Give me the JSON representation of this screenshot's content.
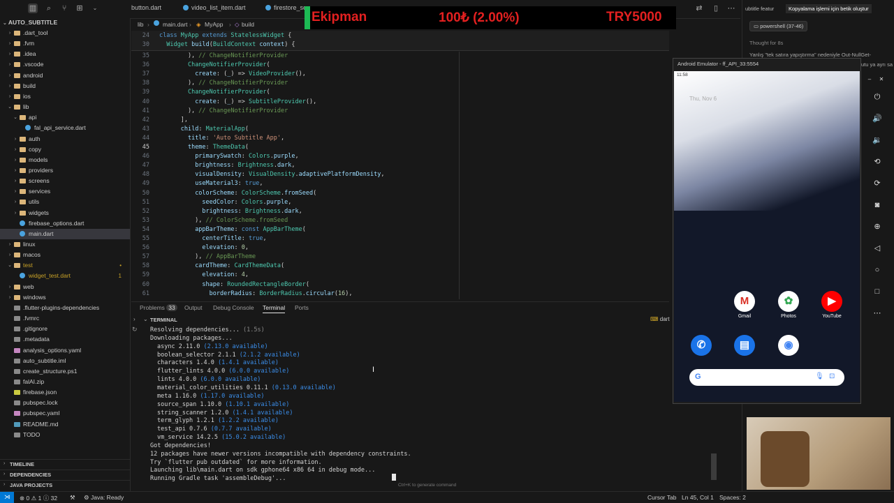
{
  "titlebar": {
    "tabs": [
      "button.dart",
      "video_list_item.dart",
      "firestore_se"
    ]
  },
  "explorer": {
    "root": "AUTO_SUBTITLE",
    "items": [
      {
        "label": ".dart_tool",
        "depth": 1,
        "type": "folder",
        "expanded": false
      },
      {
        "label": ".fvm",
        "depth": 1,
        "type": "folder",
        "expanded": false
      },
      {
        "label": ".idea",
        "depth": 1,
        "type": "folder",
        "expanded": false
      },
      {
        "label": ".vscode",
        "depth": 1,
        "type": "folder",
        "expanded": false
      },
      {
        "label": "android",
        "depth": 1,
        "type": "folder",
        "expanded": false
      },
      {
        "label": "build",
        "depth": 1,
        "type": "folder",
        "expanded": false
      },
      {
        "label": "ios",
        "depth": 1,
        "type": "folder",
        "expanded": false
      },
      {
        "label": "lib",
        "depth": 1,
        "type": "folder",
        "expanded": true
      },
      {
        "label": "api",
        "depth": 2,
        "type": "folder",
        "expanded": true
      },
      {
        "label": "fal_api_service.dart",
        "depth": 3,
        "type": "dart"
      },
      {
        "label": "auth",
        "depth": 2,
        "type": "folder",
        "expanded": false
      },
      {
        "label": "copy",
        "depth": 2,
        "type": "folder",
        "expanded": false
      },
      {
        "label": "models",
        "depth": 2,
        "type": "folder",
        "expanded": false
      },
      {
        "label": "providers",
        "depth": 2,
        "type": "folder",
        "expanded": false
      },
      {
        "label": "screens",
        "depth": 2,
        "type": "folder",
        "expanded": false
      },
      {
        "label": "services",
        "depth": 2,
        "type": "folder",
        "expanded": false
      },
      {
        "label": "utils",
        "depth": 2,
        "type": "folder",
        "expanded": false
      },
      {
        "label": "widgets",
        "depth": 2,
        "type": "folder",
        "expanded": false
      },
      {
        "label": "firebase_options.dart",
        "depth": 2,
        "type": "dart"
      },
      {
        "label": "main.dart",
        "depth": 2,
        "type": "dart",
        "selected": true
      },
      {
        "label": "linux",
        "depth": 1,
        "type": "folder",
        "expanded": false
      },
      {
        "label": "macos",
        "depth": 1,
        "type": "folder",
        "expanded": false
      },
      {
        "label": "test",
        "depth": 1,
        "type": "folder",
        "expanded": true,
        "badge": "•",
        "color": "#c9a227"
      },
      {
        "label": "widget_test.dart",
        "depth": 2,
        "type": "dart",
        "badge": "1",
        "color": "#c9a227"
      },
      {
        "label": "web",
        "depth": 1,
        "type": "folder",
        "expanded": false
      },
      {
        "label": "windows",
        "depth": 1,
        "type": "folder",
        "expanded": false
      },
      {
        "label": ".flutter-plugins-dependencies",
        "depth": 1,
        "type": "file"
      },
      {
        "label": ".fvmrc",
        "depth": 1,
        "type": "file"
      },
      {
        "label": ".gitignore",
        "depth": 1,
        "type": "file"
      },
      {
        "label": ".metadata",
        "depth": 1,
        "type": "file"
      },
      {
        "label": "analysis_options.yaml",
        "depth": 1,
        "type": "yaml"
      },
      {
        "label": "auto_subtitle.iml",
        "depth": 1,
        "type": "file"
      },
      {
        "label": "create_structure.ps1",
        "depth": 1,
        "type": "file"
      },
      {
        "label": "falAI.zip",
        "depth": 1,
        "type": "file"
      },
      {
        "label": "firebase.json",
        "depth": 1,
        "type": "json"
      },
      {
        "label": "pubspec.lock",
        "depth": 1,
        "type": "file"
      },
      {
        "label": "pubspec.yaml",
        "depth": 1,
        "type": "yaml"
      },
      {
        "label": "README.md",
        "depth": 1,
        "type": "md"
      },
      {
        "label": "TODO",
        "depth": 1,
        "type": "file"
      }
    ],
    "sections": [
      "TIMELINE",
      "DEPENDENCIES",
      "JAVA PROJECTS"
    ]
  },
  "editor": {
    "breadcrumb": [
      "lib",
      "main.dart",
      "MyApp",
      "build"
    ],
    "sticky": [
      {
        "n": "24",
        "text": "class MyApp extends StatelessWidget {"
      },
      {
        "n": "30",
        "text": "  Widget build(BuildContext context) {"
      }
    ],
    "lines": [
      {
        "n": "35",
        "text": "        ), // ChangeNotifierProvider"
      },
      {
        "n": "36",
        "text": "        ChangeNotifierProvider("
      },
      {
        "n": "37",
        "text": "          create: (_) => VideoProvider(),"
      },
      {
        "n": "38",
        "text": "        ), // ChangeNotifierProvider"
      },
      {
        "n": "39",
        "text": "        ChangeNotifierProvider("
      },
      {
        "n": "40",
        "text": "          create: (_) => SubtitleProvider(),"
      },
      {
        "n": "41",
        "text": "        ), // ChangeNotifierProvider"
      },
      {
        "n": "42",
        "text": "      ],"
      },
      {
        "n": "43",
        "text": "      child: MaterialApp("
      },
      {
        "n": "44",
        "text": "        title: 'Auto Subtitle App',"
      },
      {
        "n": "45",
        "text": "        theme: ThemeData("
      },
      {
        "n": "46",
        "text": "          primarySwatch: Colors.purple,"
      },
      {
        "n": "47",
        "text": "          brightness: Brightness.dark,"
      },
      {
        "n": "48",
        "text": "          visualDensity: VisualDensity.adaptivePlatformDensity,"
      },
      {
        "n": "49",
        "text": "          useMaterial3: true,"
      },
      {
        "n": "50",
        "text": "          colorScheme: ColorScheme.fromSeed("
      },
      {
        "n": "51",
        "text": "            seedColor: Colors.purple,"
      },
      {
        "n": "52",
        "text": "            brightness: Brightness.dark,"
      },
      {
        "n": "53",
        "text": "          ), // ColorScheme.fromSeed"
      },
      {
        "n": "54",
        "text": "          appBarTheme: const AppBarTheme("
      },
      {
        "n": "55",
        "text": "            centerTitle: true,"
      },
      {
        "n": "56",
        "text": "            elevation: 0,"
      },
      {
        "n": "57",
        "text": "          ), // AppBarTheme"
      },
      {
        "n": "58",
        "text": "          cardTheme: CardThemeData("
      },
      {
        "n": "59",
        "text": "            elevation: 4,"
      },
      {
        "n": "60",
        "text": "            shape: RoundedRectangleBorder("
      },
      {
        "n": "61",
        "text": "              borderRadius: BorderRadius.circular(16),"
      }
    ]
  },
  "panel": {
    "tabs": [
      "Problems",
      "Output",
      "Debug Console",
      "Terminal",
      "Ports"
    ],
    "problems_count": "33",
    "active_tab": "Terminal",
    "terminal_title": "TERMINAL",
    "terminal_name": "dart",
    "lines": [
      {
        "text": "Resolving dependencies...",
        "extra": " (1.5s)",
        "indent": false
      },
      {
        "text": "Downloading packages...",
        "extra": "",
        "indent": false
      },
      {
        "text": "async 2.11.0",
        "extra": " (2.13.0 available)",
        "indent": true
      },
      {
        "text": "boolean_selector 2.1.1",
        "extra": " (2.1.2 available)",
        "indent": true
      },
      {
        "text": "characters 1.4.0",
        "extra": " (1.4.1 available)",
        "indent": true
      },
      {
        "text": "flutter_lints 4.0.0",
        "extra": " (6.0.0 available)",
        "indent": true
      },
      {
        "text": "lints 4.0.0",
        "extra": " (6.0.0 available)",
        "indent": true
      },
      {
        "text": "material_color_utilities 0.11.1",
        "extra": " (0.13.0 available)",
        "indent": true
      },
      {
        "text": "meta 1.16.0",
        "extra": " (1.17.0 available)",
        "indent": true
      },
      {
        "text": "source_span 1.10.0",
        "extra": " (1.10.1 available)",
        "indent": true
      },
      {
        "text": "string_scanner 1.2.0",
        "extra": " (1.4.1 available)",
        "indent": true
      },
      {
        "text": "term_glyph 1.2.1",
        "extra": " (1.2.2 available)",
        "indent": true
      },
      {
        "text": "test_api 0.7.6",
        "extra": " (0.7.7 available)",
        "indent": true
      },
      {
        "text": "vm_service 14.2.5",
        "extra": " (15.0.2 available)",
        "indent": true
      },
      {
        "text": "Got dependencies!",
        "extra": "",
        "indent": false
      },
      {
        "text": "12 packages have newer versions incompatible with dependency constraints.",
        "extra": "",
        "indent": false
      },
      {
        "text": "Try `flutter pub outdated` for more information.",
        "extra": "",
        "indent": false
      },
      {
        "text": "Launching lib\\main.dart on sdk gphone64 x86 64 in debug mode...",
        "extra": "",
        "indent": false
      },
      {
        "text": "Running Gradle task 'assembleDebug'...",
        "extra": "",
        "indent": false
      }
    ],
    "hint": "Ctrl+K to generate command"
  },
  "statusbar": {
    "errors": "0",
    "warnings": "1",
    "info": "32",
    "java": "Java: Ready",
    "cursor_tab": "Cursor Tab",
    "position": "Ln 45, Col 1",
    "spaces": "Spaces: 2"
  },
  "banner": {
    "name": "Ekipman",
    "amount": "100₺ (2.00%)",
    "goal": "TRY5000"
  },
  "chat": {
    "tabs": [
      "ubtitle featur",
      "Kopyalama işlemi için betik oluştur"
    ],
    "chip": "powershell (37-46)",
    "thought": "Thought for 8s",
    "snippet": "Yanlış \"tek satıra yapıştırma\" nedeniyle Out-NullGet-",
    "snippet2": "utu ya ayrı sa"
  },
  "emulator": {
    "title": "Android Emulator - ff_API_33:5554",
    "time": "11:58",
    "date": "Thu, Nov 6",
    "apps_row1": [
      {
        "label": "Gmail",
        "color": "#ffffff",
        "glyph": "M",
        "glyph_color": "#d93025"
      },
      {
        "label": "Photos",
        "color": "#ffffff",
        "glyph": "✿",
        "glyph_color": "#34a853"
      },
      {
        "label": "YouTube",
        "color": "#ff0000",
        "glyph": "▶",
        "glyph_color": "#ffffff"
      }
    ],
    "apps_row2": [
      {
        "label": "",
        "color": "#1a73e8",
        "glyph": "✆",
        "glyph_color": "#ffffff"
      },
      {
        "label": "",
        "color": "#1a73e8",
        "glyph": "▤",
        "glyph_color": "#ffffff"
      },
      {
        "label": "",
        "color": "#ffffff",
        "glyph": "◉",
        "glyph_color": "#4285f4"
      }
    ],
    "search_logo": "G"
  }
}
